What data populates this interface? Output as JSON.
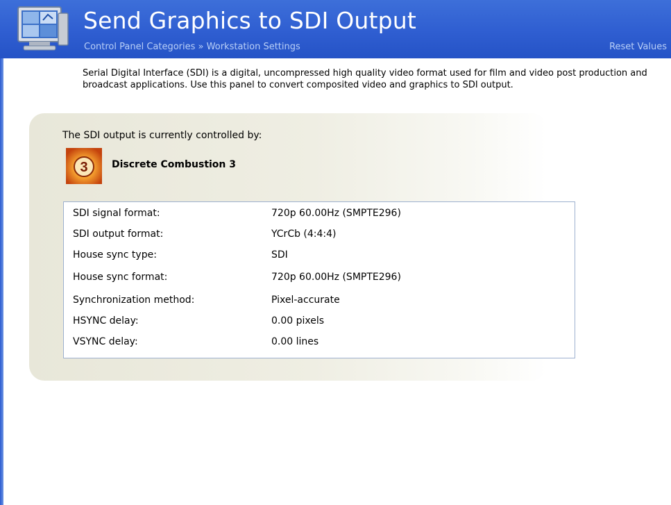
{
  "header": {
    "title": "Send Graphics to SDI Output",
    "breadcrumb": {
      "parent": "Control Panel Categories",
      "separator": "»",
      "current": "Workstation Settings"
    },
    "reset_label": "Reset Values",
    "icon": "monitor-workstation-icon",
    "colors": {
      "bar": "#2f5ed1",
      "link": "#b9cff7"
    }
  },
  "description": "Serial Digital Interface (SDI) is a digital, uncompressed high quality video format used for film and video post production and broadcast applications. Use this panel to convert composited video and graphics to SDI output.",
  "controller": {
    "label": "The SDI output is currently controlled by:",
    "app_name": "Discrete Combustion 3",
    "app_icon_glyph": "3",
    "app_icon": "combustion-app-icon"
  },
  "info": {
    "rows": [
      {
        "label": "SDI signal format:",
        "value": "720p 60.00Hz (SMPTE296)"
      },
      {
        "label": "SDI output format:",
        "value": "YCrCb (4:4:4)"
      },
      {
        "label": "House sync type:",
        "value": "SDI"
      },
      {
        "label": "House sync format:",
        "value": "720p 60.00Hz (SMPTE296)"
      },
      {
        "label": "Synchronization method:",
        "value": "Pixel-accurate"
      },
      {
        "label": "HSYNC delay:",
        "value": "0.00 pixels"
      },
      {
        "label": "VSYNC delay:",
        "value": "0.00 lines"
      }
    ]
  }
}
